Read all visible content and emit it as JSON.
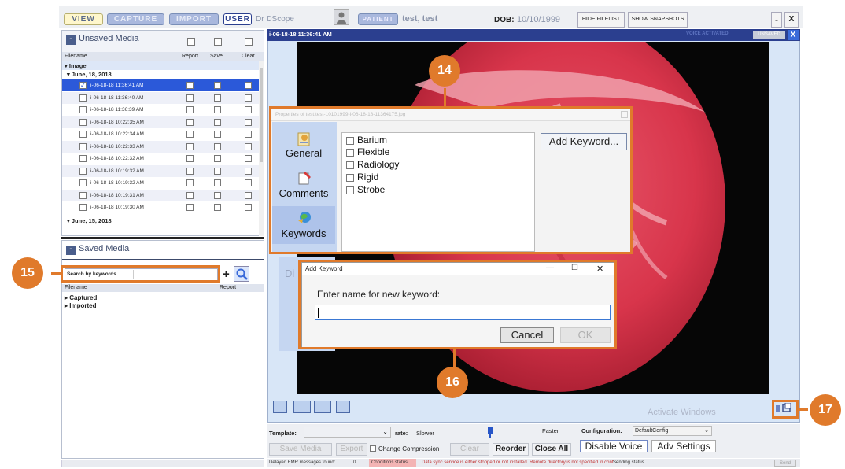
{
  "topbar": {
    "view": "VIEW",
    "capture": "CAPTURE",
    "import": "IMPORT",
    "user": "USER",
    "user_name": "Dr DScope",
    "patient_label": "PATIENT",
    "patient_name": "test, test",
    "dob_label": "DOB:",
    "dob_value": "10/10/1999",
    "hide_filelist": "HIDE FILELIST",
    "show_snapshots": "SHOW SNAPSHOTS",
    "minimize": "-",
    "close": "X"
  },
  "unsaved": {
    "title": "Unsaved Media",
    "col_filename": "Filename",
    "col_report": "Report",
    "col_save": "Save",
    "col_clear": "Clear",
    "group_image": "Image",
    "date1": "June, 18, 2018",
    "files": [
      "i-06-18-18 11:36:41 AM",
      "i-06-18-18 11:36:40 AM",
      "i-06-18-18 11:36:39 AM",
      "i-06-18-18 10:22:35 AM",
      "i-06-18-18 10:22:34 AM",
      "i-06-18-18 10:22:33 AM",
      "i-06-18-18 10:22:32 AM",
      "i-06-18-18 10:19:32 AM",
      "i-06-18-18 10:19:32 AM",
      "i-06-18-18 10:19:31 AM",
      "i-06-18-18 10:19:30 AM"
    ],
    "date2": "June, 15, 2018"
  },
  "saved": {
    "title": "Saved Media",
    "search_label": "Search by keywords",
    "plus": "+",
    "col_filename": "Filename",
    "col_report": "Report",
    "captured": "Captured",
    "imported": "Imported"
  },
  "viewer": {
    "timestamp": "i-06-18-18 11:36:41 AM",
    "voice_activated": "VOICE ACTIVATED",
    "unsaved": "UNSAVED",
    "close": "X",
    "activate_windows": "Activate Windows"
  },
  "properties": {
    "title": "Properties of test,test-10101999-i-06-18-18-11364175.jpg",
    "general": "General",
    "comments": "Comments",
    "keywords": "Keywords",
    "partial_tab": "Di",
    "keyword_items": [
      "Barium",
      "Flexible",
      "Radiology",
      "Rigid",
      "Strobe"
    ],
    "add_keyword": "Add Keyword..."
  },
  "add_keyword_dialog": {
    "title": "Add Keyword",
    "minimize": "—",
    "maximize": "☐",
    "close": "✕",
    "prompt": "Enter name for new keyword:",
    "input_value": "",
    "cancel": "Cancel",
    "ok": "OK"
  },
  "controls": {
    "template_label": "Template:",
    "rate_label": "rate:",
    "slower": "Slower",
    "faster": "Faster",
    "config_label": "Configuration:",
    "config_value": "DefaultConfig",
    "save_media": "Save Media",
    "export": "Export",
    "change_compression": "Change Compression",
    "clear": "Clear",
    "reorder": "Reorder",
    "close_all": "Close All",
    "disable_voice": "Disable Voice",
    "adv_settings": "Adv Settings"
  },
  "status": {
    "delayed": "Delayed EMR messages found:",
    "delayed_count": "0",
    "conditions": "Conditions status",
    "sync_msg": "Data sync service is either stopped or not installed. Remote directory is not specified in conf",
    "sending": "Sending status",
    "send_btn": "Send"
  },
  "callouts": {
    "c14": "14",
    "c15": "15",
    "c16": "16",
    "c17": "17"
  },
  "colors": {
    "accent": "#e07a2b",
    "selection": "#2b59d9",
    "titlebar": "#2b3f8f"
  }
}
